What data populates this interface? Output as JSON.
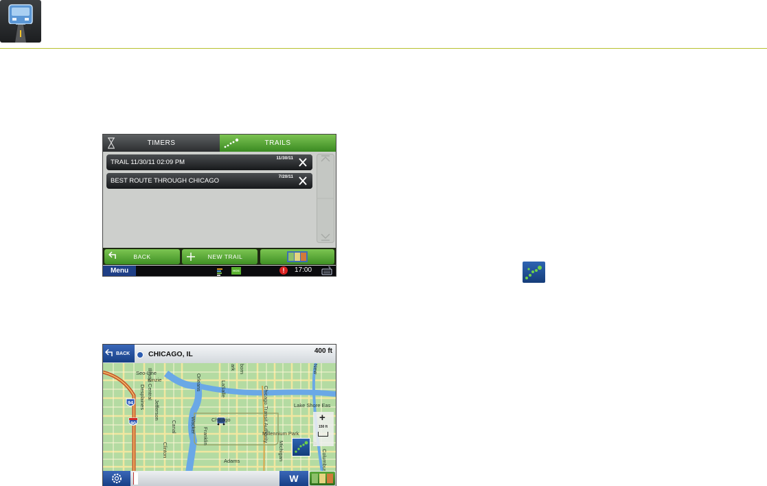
{
  "colors": {
    "accent_green": "#56a637",
    "header_rule": "#b7c02c",
    "menu_blue": "#1f3f86"
  },
  "header": {
    "icon": "truck-road-icon"
  },
  "trails_screen": {
    "tabs": [
      {
        "label": "TIMERS",
        "icon": "hourglass-icon",
        "active": false
      },
      {
        "label": "TRAILS",
        "icon": "trail-dots-icon",
        "active": true
      }
    ],
    "trails": [
      {
        "name": "TRAIL 11/30/11 02:09 PM",
        "date": "11/30/11"
      },
      {
        "name": "BEST ROUTE THROUGH CHICAGO",
        "date": "7/20/11"
      }
    ],
    "buttons": {
      "back": "BACK",
      "new_trail": "NEW TRAIL"
    },
    "status": {
      "menu": "Menu",
      "time": "17:00",
      "hos": "HOS"
    }
  },
  "trail_icon": "trail-dots-icon",
  "map_screen": {
    "back_label": "BACK",
    "title": "CHICAGO, IL",
    "scale_top": "400 ft",
    "scale_side": "150 ft",
    "heading": "W",
    "road_labels": {
      "seo_line": "Seo-Line",
      "kinzie": "Kinzie",
      "desplaines": "Desplaines",
      "illinois_central": "Illinois Central",
      "jefferson": "Jefferson",
      "canal": "Canal",
      "clinton": "Clinton",
      "orleans": "Orleans",
      "wacker": "Wacker",
      "lasalle": "LaSalle",
      "franklin": "Franklin",
      "adams": "Adams",
      "chicago": "Chicago",
      "chicago_transit": "Chicago Transit Authority",
      "lake_shore": "Lake Shore Eas",
      "millennium": "Millennium Park",
      "new_label": "New",
      "dearborn": "born",
      "park": "ark",
      "michigan": "Michigan",
      "columbus": "Columbus",
      "ls": "ls"
    },
    "interstates": [
      "94",
      "90"
    ]
  }
}
